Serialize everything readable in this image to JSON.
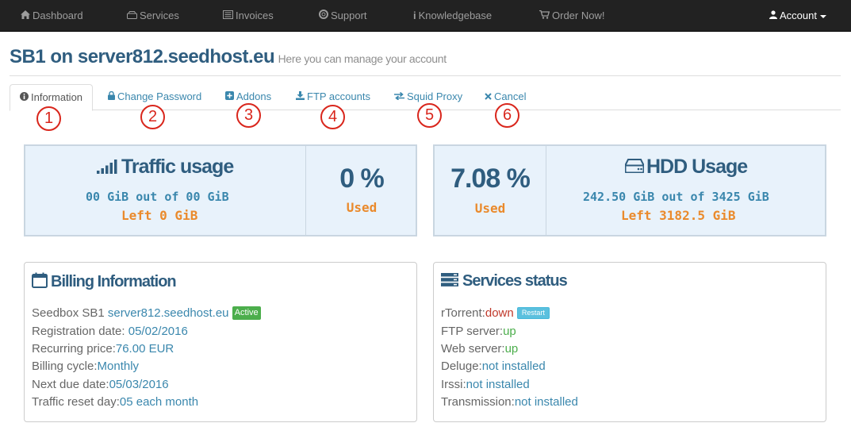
{
  "nav": {
    "dashboard": "Dashboard",
    "services": "Services",
    "invoices": "Invoices",
    "support": "Support",
    "knowledgebase": "Knowledgebase",
    "order_now": "Order Now!",
    "account": "Account"
  },
  "header": {
    "title": "SB1 on server812.seedhost.eu",
    "subtitle": "Here you can manage your account"
  },
  "tabs": [
    {
      "label": "Information",
      "icon": "info-circle-icon",
      "marker": "1"
    },
    {
      "label": "Change Password",
      "icon": "lock-icon",
      "marker": "2"
    },
    {
      "label": "Addons",
      "icon": "plus-square-icon",
      "marker": "3"
    },
    {
      "label": "FTP accounts",
      "icon": "download-icon",
      "marker": "4"
    },
    {
      "label": "Squid Proxy",
      "icon": "exchange-icon",
      "marker": "5"
    },
    {
      "label": "Cancel",
      "icon": "close-icon",
      "marker": "6"
    }
  ],
  "traffic": {
    "title": "Traffic usage",
    "line1": "00 GiB out of 00 GiB",
    "line2": "Left 0 GiB",
    "percent": "0 %",
    "used_label": "Used"
  },
  "hdd": {
    "title": "HDD Usage",
    "line1": "242.50 GiB out of 3425 GiB",
    "line2": "Left 3182.5 GiB",
    "percent": "7.08 %",
    "used_label": "Used"
  },
  "billing": {
    "title": "Billing Information",
    "product_label": "Seedbox SB1",
    "product_host": "server812.seedhost.eu",
    "status_badge": "Active",
    "rows": [
      {
        "label": "Registration date:",
        "value": "05/02/2016"
      },
      {
        "label": "Recurring price:",
        "value": "76.00 EUR"
      },
      {
        "label": "Billing cycle:",
        "value": "Monthly"
      },
      {
        "label": "Next due date:",
        "value": "05/03/2016"
      },
      {
        "label": "Traffic reset day:",
        "value": "05 each month"
      }
    ]
  },
  "services_status": {
    "title": "Services status",
    "restart_label": "Restart",
    "rows": [
      {
        "label": "rTorrent:",
        "value": "down"
      },
      {
        "label": "FTP server:",
        "value": "up"
      },
      {
        "label": "Web server:",
        "value": "up"
      },
      {
        "label": "Deluge:",
        "value": "not installed"
      },
      {
        "label": "Irssi:",
        "value": "not installed"
      },
      {
        "label": "Transmission:",
        "value": "not installed"
      }
    ]
  },
  "colors": {
    "navbar": "#222222",
    "title_blue": "#2f5d7f",
    "link_blue": "#3a87ad",
    "orange": "#ea8a2c",
    "panel_bg": "#e8f2fb",
    "green": "#4cae4c",
    "red": "#c0392b",
    "marker_red": "#d9261c"
  }
}
